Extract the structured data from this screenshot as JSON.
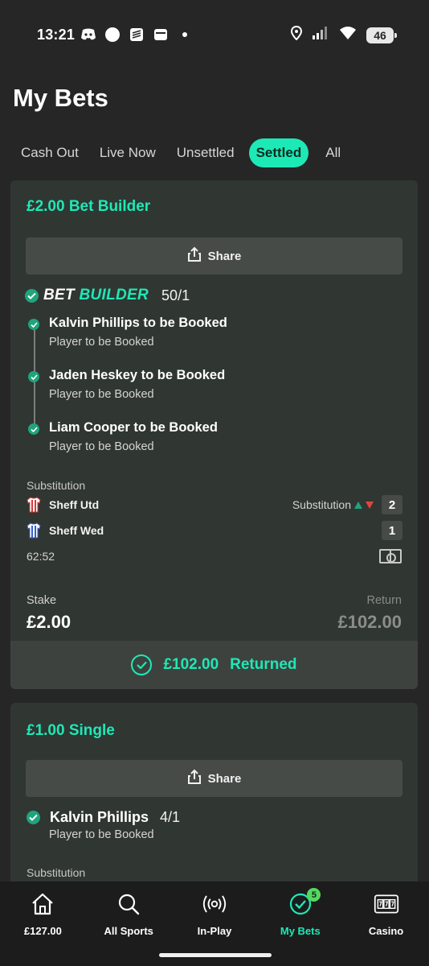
{
  "status_bar": {
    "time": "13:21",
    "battery": "46",
    "left_icons": [
      "discord-icon",
      "circle-icon",
      "stack-icon",
      "wallet-icon",
      "dot-icon"
    ],
    "right_icons": [
      "location-icon",
      "signal-icon",
      "wifi-icon",
      "battery-icon"
    ]
  },
  "header": {
    "title": "My Bets"
  },
  "tabs": [
    {
      "label": "Cash Out",
      "active": false
    },
    {
      "label": "Live Now",
      "active": false
    },
    {
      "label": "Unsettled",
      "active": false
    },
    {
      "label": "Settled",
      "active": true
    },
    {
      "label": "All",
      "active": false
    }
  ],
  "bets": [
    {
      "title": "£2.00 Bet Builder",
      "share_label": "Share",
      "builder_word_1": "BET",
      "builder_word_2": "BUILDER",
      "odds": "50/1",
      "legs": [
        {
          "title": "Kalvin Phillips to be Booked",
          "market": "Player to be Booked"
        },
        {
          "title": "Jaden Heskey to be Booked",
          "market": "Player to be Booked"
        },
        {
          "title": "Liam Cooper to be Booked",
          "market": "Player to be Booked"
        }
      ],
      "match": {
        "event_label": "Substitution",
        "home_team": "Sheff Utd",
        "away_team": "Sheff Wed",
        "home_event": "Substitution",
        "home_score": "2",
        "away_score": "1",
        "clock": "62:52"
      },
      "stake_label": "Stake",
      "stake_value": "£2.00",
      "return_label": "Return",
      "return_value": "£102.00",
      "result_amount": "£102.00",
      "result_label": "Returned"
    },
    {
      "title": "£1.00 Single",
      "share_label": "Share",
      "selection": "Kalvin Phillips",
      "odds": "4/1",
      "market": "Player to be Booked",
      "event_label": "Substitution"
    }
  ],
  "bottom_nav": [
    {
      "label": "£127.00",
      "icon": "home-icon"
    },
    {
      "label": "All Sports",
      "icon": "search-icon"
    },
    {
      "label": "In-Play",
      "icon": "broadcast-icon"
    },
    {
      "label": "My Bets",
      "icon": "check-circle-icon",
      "badge": "5",
      "active": true
    },
    {
      "label": "Casino",
      "icon": "slot-machine-icon"
    }
  ],
  "colors": {
    "accent": "#1de9b6",
    "background": "#262626",
    "card": "#303632",
    "success": "#1fa47c",
    "loss": "#e0463c"
  }
}
